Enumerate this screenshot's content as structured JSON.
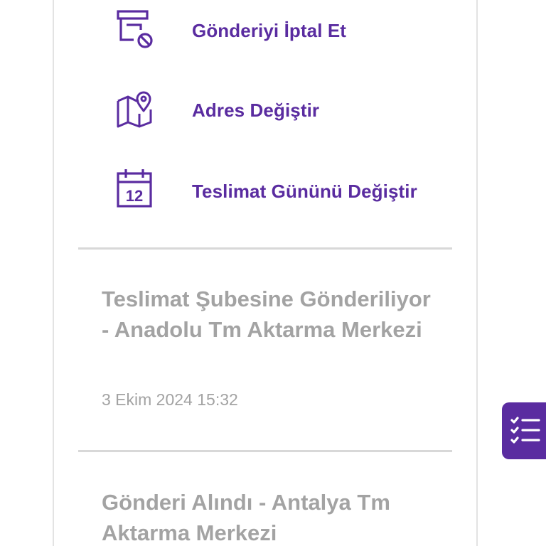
{
  "actions": {
    "cancel": {
      "label": "Gönderiyi İptal Et",
      "icon": "cancel-shipment-icon"
    },
    "address": {
      "label": "Adres Değiştir",
      "icon": "map-pin-icon"
    },
    "delivery_day": {
      "label": "Teslimat Gününü Değiştir",
      "icon": "calendar-icon",
      "calendar_number": "12"
    }
  },
  "timeline": [
    {
      "title": "Teslimat Şubesine Gönderiliyor - Anadolu Tm Aktarma Merkezi",
      "date": "3 Ekim 2024 15:32"
    },
    {
      "title": "Gönderi Alındı - Antalya Tm Aktarma Merkezi"
    }
  ],
  "fab": {
    "icon": "checklist-icon"
  },
  "colors": {
    "accent": "#5a2ca0",
    "muted_text": "#a3a3a3",
    "divider": "#d8d8d8",
    "border": "#e3e3e3"
  }
}
